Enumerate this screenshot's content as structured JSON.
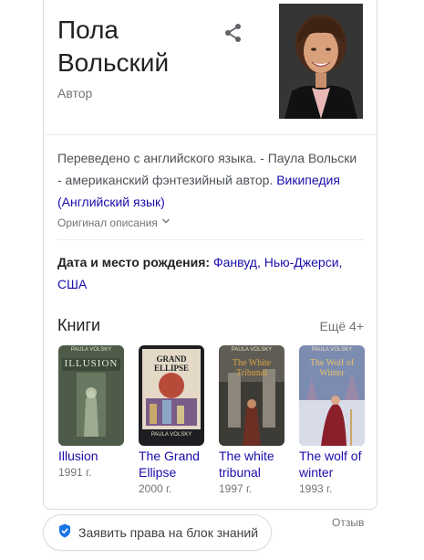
{
  "entity": {
    "name_line1": "Пола",
    "name_line2": "Вольский",
    "type": "Автор"
  },
  "icons": {
    "share": "share-icon",
    "shield": "verified-shield-icon",
    "chevron": "chevron-down-icon"
  },
  "description": {
    "text": "Переведено с английского языка. - Паула Вольски - американский фэнтезийный автор.",
    "source_link": "Википедия (Английский язык)",
    "original_toggle": "Оригинал описания"
  },
  "born": {
    "label": "Дата и место рождения:",
    "value": "Фанвуд, Нью-Джерси, США"
  },
  "books": {
    "heading": "Книги",
    "more_label": "Ещё 4+",
    "items": [
      {
        "title": "Illusion",
        "year": "1991 г.",
        "cover_text": "ILLUSION",
        "author": "PAULA VOLSKY"
      },
      {
        "title": "The Grand Ellipse",
        "year": "2000 г.",
        "cover_text": "GRAND ELLIPSE",
        "author": "PAULA VOLSKY"
      },
      {
        "title": "The white tribunal",
        "year": "1997 г.",
        "cover_text": "The White Tribunal",
        "author": "PAULA VOLSKY"
      },
      {
        "title": "The wolf of winter",
        "year": "1993 г.",
        "cover_text": "The Wolf of Winter",
        "author": "PAULA VOLSKY"
      }
    ]
  },
  "footer": {
    "claim_label": "Заявить права на блок знаний",
    "feedback_label": "Отзыв"
  },
  "colors": {
    "link": "#1a0dab",
    "secondary": "#70757a",
    "accent": "#1a73e8"
  }
}
